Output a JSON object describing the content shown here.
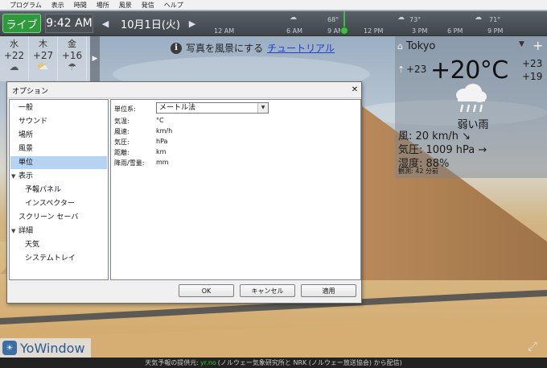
{
  "menu": [
    "プログラム",
    "表示",
    "時間",
    "場所",
    "風景",
    "発信",
    "ヘルプ"
  ],
  "toolbar": {
    "live_label": "ライブ",
    "time": "9:42 AM",
    "date": "10月1日(火)",
    "prev_icon": "chevron-left-icon",
    "next_icon": "chevron-right-icon"
  },
  "timeline": {
    "hours": [
      "12 AM",
      "6 AM",
      "9 AM",
      "12 PM",
      "3 PM",
      "6 PM",
      "9 PM"
    ],
    "temps": [
      "68°",
      "73°",
      "71°"
    ],
    "marker_color": "#3fbf3f"
  },
  "forecast": [
    {
      "day": "水",
      "temp": "+22",
      "icon": "cloud-icon"
    },
    {
      "day": "木",
      "temp": "+27",
      "icon": "partly-cloudy-icon"
    },
    {
      "day": "金",
      "temp": "+16",
      "icon": "rain-cloud-icon"
    }
  ],
  "tutorial": {
    "text": "写真を風景にする",
    "link": "チュートリアル"
  },
  "weather": {
    "city": "Tokyo",
    "feels_like": "+23",
    "temperature": "+20°C",
    "high": "+23",
    "low": "+19",
    "condition": "弱い雨",
    "wind": "風:  20 km/h ↘",
    "pressure": "気圧:  1009 hPa →",
    "humidity": "湿度:  88%",
    "observed": "観測:  42 分前"
  },
  "brand": {
    "name": "YoWindow"
  },
  "status": {
    "prefix": "天気予報の提供元:",
    "provider": "yr.no",
    "suffix": "(ノルウェー気象研究所と NRK (ノルウェー放送協会) から配信)"
  },
  "dialog": {
    "title": "オプション",
    "tree": [
      {
        "label": "一般",
        "level": 0,
        "expander": "",
        "selected": false
      },
      {
        "label": "サウンド",
        "level": 0,
        "expander": "",
        "selected": false
      },
      {
        "label": "場所",
        "level": 0,
        "expander": "",
        "selected": false
      },
      {
        "label": "風景",
        "level": 0,
        "expander": "",
        "selected": false
      },
      {
        "label": "単位",
        "level": 0,
        "expander": "",
        "selected": true
      },
      {
        "label": "表示",
        "level": 0,
        "expander": "▼",
        "selected": false
      },
      {
        "label": "予報パネル",
        "level": 1,
        "expander": "",
        "selected": false
      },
      {
        "label": "インスペクター",
        "level": 1,
        "expander": "",
        "selected": false
      },
      {
        "label": "スクリーン セーバ",
        "level": 0,
        "expander": "",
        "selected": false
      },
      {
        "label": "詳細",
        "level": 0,
        "expander": "▼",
        "selected": false
      },
      {
        "label": "天気",
        "level": 1,
        "expander": "",
        "selected": false
      },
      {
        "label": "システムトレイ",
        "level": 1,
        "expander": "",
        "selected": false
      }
    ],
    "units_label": "単位系:",
    "units_value": "メートル法",
    "unit_rows": [
      {
        "label": "気温:",
        "value": "°C"
      },
      {
        "label": "風速:",
        "value": "km/h"
      },
      {
        "label": "気圧:",
        "value": "hPa"
      },
      {
        "label": "距離:",
        "value": "km"
      },
      {
        "label": "降雨/雪量:",
        "value": "mm"
      }
    ],
    "buttons": {
      "ok": "OK",
      "cancel": "キャンセル",
      "apply": "適用"
    }
  }
}
